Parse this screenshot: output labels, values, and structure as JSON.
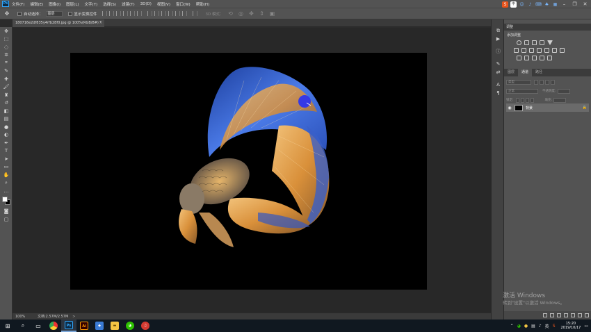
{
  "menu": {
    "app_logo": "Ps",
    "items": [
      "文件(F)",
      "编辑(E)",
      "图像(I)",
      "图层(L)",
      "文字(Y)",
      "选择(S)",
      "滤镜(T)",
      "3D(D)",
      "视图(V)",
      "窗口(W)",
      "帮助(H)"
    ]
  },
  "options": {
    "auto_select_label": "自动选择：",
    "auto_select_value": "图层",
    "show_transform_label": "显示变换控件",
    "mode_3d_label": "3D 模式："
  },
  "document": {
    "tab_title": "180716e2df835y4rfb28f0.jpg @ 100%(RGB/8#) *",
    "tab_close": "×"
  },
  "status": {
    "zoom": "100%",
    "doc_size": "文档:2.57M/2.57M",
    "arrow": ">"
  },
  "panels": {
    "adjustments_tab": "调整",
    "add_adjustment": "添加调整",
    "tabs": [
      "图层",
      "通道",
      "路径"
    ],
    "active_tab": "通道",
    "kind_label": "类型",
    "blend_mode": "正常",
    "opacity_label": "不透明度:",
    "lock_label": "锁定:",
    "fill_label": "填充:",
    "layer_name": "背景"
  },
  "watermark": {
    "title": "激活 Windows",
    "subtitle": "转到\"设置\"以激活 Windows。"
  },
  "taskbar": {
    "tray_lang": "英",
    "time": "15:20",
    "date": "2019/10/17"
  },
  "colors": {
    "accent_ps": "#31a8ff",
    "fish_blue": "#2f5fd8",
    "fish_gold": "#e3a24a",
    "brush_cursor": "#1e2bff"
  }
}
